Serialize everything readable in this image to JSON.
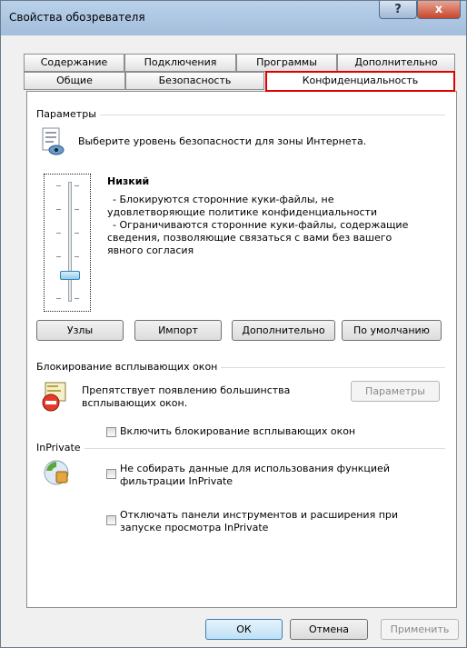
{
  "window": {
    "title": "Свойства обозревателя",
    "help_label": "?",
    "close_label": "x"
  },
  "tabs": {
    "row1": [
      "Содержание",
      "Подключения",
      "Программы",
      "Дополнительно"
    ],
    "row2": [
      "Общие",
      "Безопасность",
      "Конфиденциальность"
    ]
  },
  "params": {
    "group_label": "Параметры",
    "zone_text": "Выберите уровень безопасности для зоны Интернета.",
    "level_title": "Низкий",
    "level_desc_1": "- Блокируются сторонние куки-файлы, не",
    "level_desc_2": "удовлетворяющие политике конфиденциальности",
    "level_desc_3": "- Ограничиваются сторонние куки-файлы, содержащие",
    "level_desc_4": "сведения, позволяющие связаться с вами без вашего",
    "level_desc_5": "явного согласия",
    "slider_level": "Низкий"
  },
  "buttons": {
    "sites": "Узлы",
    "import": "Импорт",
    "advanced": "Дополнительно",
    "default": "По умолчанию"
  },
  "popup": {
    "group_label": "Блокирование всплывающих окон",
    "desc_1": "Препятствует появлению большинства",
    "desc_2": "всплывающих окон.",
    "settings_button": "Параметры",
    "enable_label": "Включить блокирование всплывающих окон"
  },
  "inprivate": {
    "group_label": "InPrivate",
    "opt1_line1": "Не собирать данные для использования функцией",
    "opt1_line2": "фильтрации InPrivate",
    "opt2_line1": "Отключать панели инструментов и расширения при",
    "opt2_line2": "запуске просмотра InPrivate"
  },
  "footer": {
    "ok": "ОК",
    "cancel": "Отмена",
    "apply": "Применить"
  }
}
